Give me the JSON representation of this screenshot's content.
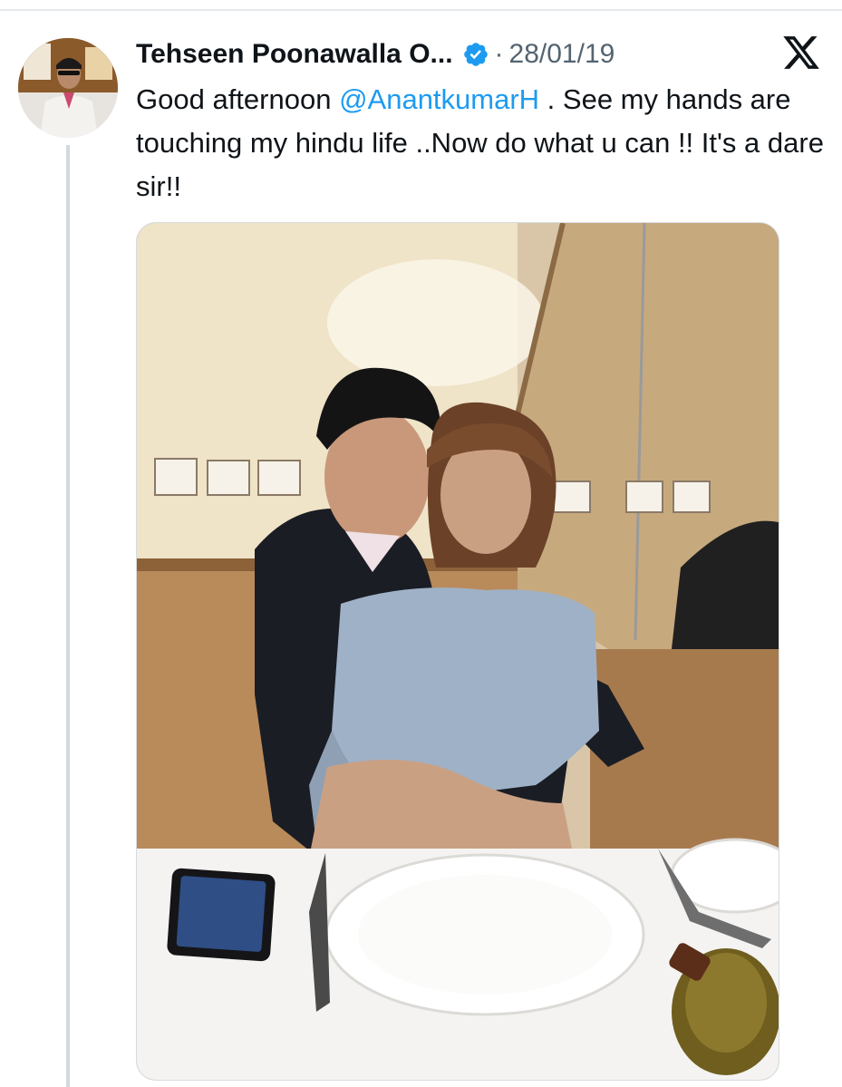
{
  "tweet": {
    "author_name": "Tehseen Poonawalla O...",
    "separator": "·",
    "date": "28/01/19",
    "text_before": "Good afternoon ",
    "mention": "@AnantkumarH",
    "text_after": " . See my hands are touching my hindu life ..Now do what u can !! It's a dare sir!!",
    "verified_icon": "verified-badge-icon",
    "platform_icon": "x-logo-icon",
    "verified_color": "#1d9bf0",
    "mention_color": "#1d9bf0"
  }
}
